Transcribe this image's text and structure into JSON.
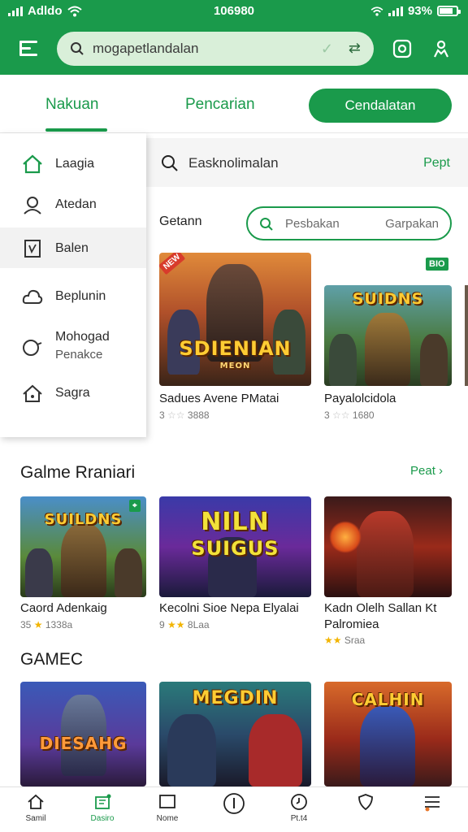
{
  "status_bar": {
    "carrier": "Adldo",
    "time": "106980",
    "battery": "93%"
  },
  "header": {
    "search_value": "mogapetlandalan"
  },
  "tabs": {
    "tab1": "Nakuan",
    "tab2": "Pencarian",
    "signup": "Cendalatan"
  },
  "side_menu": {
    "items": [
      {
        "label": "Laagia",
        "icon": "home-icon"
      },
      {
        "label": "Atedan",
        "icon": "person-icon"
      },
      {
        "label": "Balen",
        "icon": "document-icon"
      },
      {
        "label": "Beplunin",
        "icon": "cloud-icon"
      },
      {
        "label": "Mohogad",
        "label2": "Penakce",
        "icon": "chat-icon"
      },
      {
        "label": "Sagra",
        "icon": "house-lock-icon"
      }
    ]
  },
  "content_search": {
    "text": "Easknolimalan",
    "link": "Pept"
  },
  "filter": {
    "title": "Getann",
    "placeholder": "Pesbakan",
    "secondary": "Garpakan"
  },
  "featured": [
    {
      "title": "Sadues Avene PMatai",
      "rating": "3",
      "count": "3888",
      "art_title": "SDIENIAN",
      "art_sub": "MEON",
      "badge": ""
    },
    {
      "title": "Payalolcidola",
      "rating": "3",
      "count": "1680",
      "art_title": "SUIDNS",
      "art_sub": "",
      "badge": "BIO"
    }
  ],
  "section1": {
    "title": "Galme Rraniari",
    "more": "Peat",
    "items": [
      {
        "title": "Caord Adenkaig",
        "rating": "35",
        "count": "1338a",
        "art_title": "SUILDNS",
        "art_sub": ""
      },
      {
        "title": "Kecolni Sioe Nepa Elyalai",
        "rating": "9",
        "count": "8Laa",
        "art_title": "NILN",
        "art_sub": "SUIGUS"
      },
      {
        "title": "Kadn Olelh Sallan  Kt",
        "title2": "Palromiea",
        "rating": "",
        "count": "Sraa",
        "art_title": "",
        "art_sub": ""
      }
    ]
  },
  "section2": {
    "title": "GAMEC",
    "items": [
      {
        "art_title": "DIESAHG"
      },
      {
        "art_title": "MEGDIN"
      },
      {
        "art_title": "CALHIN"
      }
    ]
  },
  "bottom_nav": [
    {
      "label": "Samil",
      "icon": "home-icon"
    },
    {
      "label": "Dasiro",
      "icon": "store-icon",
      "active": true
    },
    {
      "label": "Nome",
      "icon": "square-icon"
    },
    {
      "label": "",
      "icon": "compass-icon"
    },
    {
      "label": "Pt.t4",
      "icon": "clock-icon"
    },
    {
      "label": "",
      "icon": "shield-icon"
    },
    {
      "label": "",
      "icon": "menu-icon"
    }
  ],
  "colors": {
    "primary": "#1a9a4b",
    "search_bg": "#d9efd9"
  }
}
